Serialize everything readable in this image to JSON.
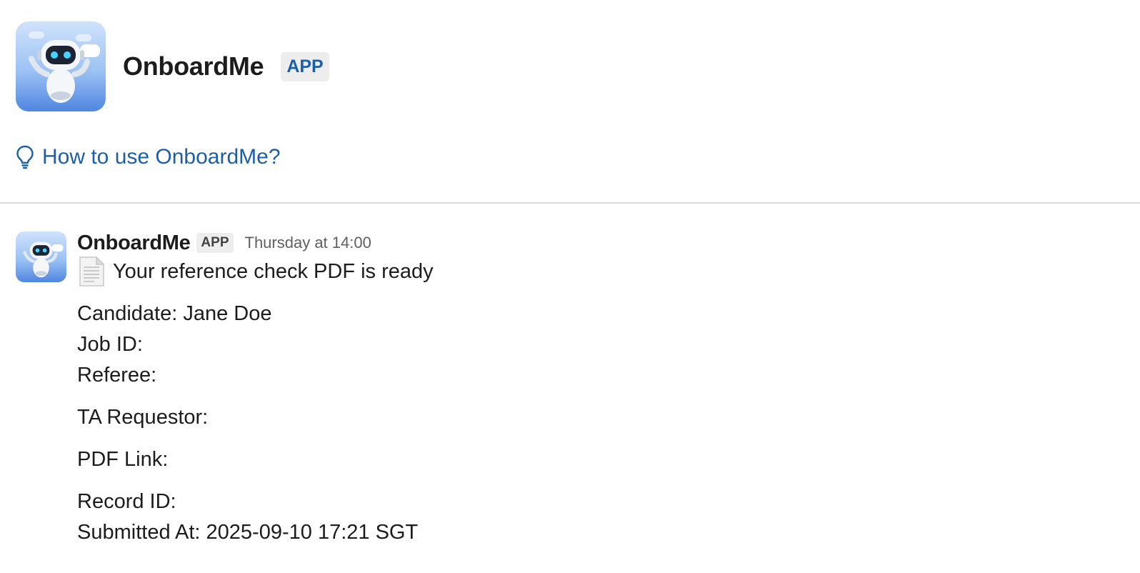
{
  "header": {
    "app_name": "OnboardMe",
    "badge": "APP",
    "avatar_icon": "robot-avatar-icon"
  },
  "help": {
    "icon": "lightbulb-icon",
    "label": "How to use OnboardMe?"
  },
  "message": {
    "sender": "OnboardMe",
    "badge": "APP",
    "timestamp": "Thursday at 14:00",
    "avatar_icon": "robot-avatar-icon",
    "headline_icon": "page-facing-up-icon",
    "headline": "Your reference check PDF is ready",
    "fields": {
      "candidate": "Candidate: Jane Doe",
      "job_id": "Job ID:",
      "referee": "Referee:",
      "ta_requestor": "TA Requestor:",
      "pdf_link": "PDF Link:",
      "record_id": "Record ID:",
      "submitted_at": "Submitted At: 2025-09-10 17:21 SGT"
    }
  },
  "colors": {
    "link": "#1d5ea8",
    "badge_bg": "#ededed",
    "divider": "#dddddd",
    "avatar_gradient_top": "#cfe2fb",
    "avatar_gradient_bottom": "#4f86e0"
  }
}
